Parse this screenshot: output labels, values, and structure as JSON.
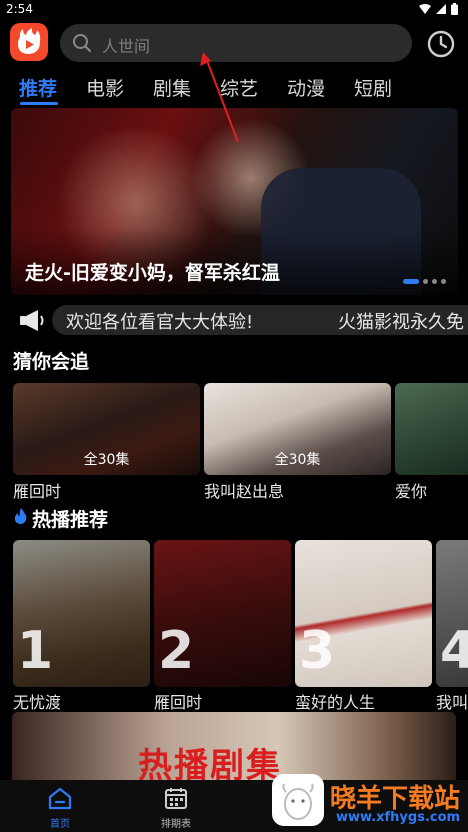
{
  "status_bar": {
    "time": "2:54"
  },
  "search": {
    "placeholder": "人世间"
  },
  "tabs": [
    {
      "label": "推荐",
      "active": true
    },
    {
      "label": "电影"
    },
    {
      "label": "剧集"
    },
    {
      "label": "综艺"
    },
    {
      "label": "动漫"
    },
    {
      "label": "短剧"
    }
  ],
  "banner": {
    "title": "走火-旧爱变小妈，督军杀红温"
  },
  "notice": {
    "text": "欢迎各位看官大大体验!",
    "text2": "火猫影视永久免"
  },
  "guess": {
    "title": "猜你会追",
    "items": [
      {
        "name": "雁回时",
        "badge": "全30集"
      },
      {
        "name": "我叫赵出息",
        "badge": "全30集"
      },
      {
        "name": "爱你",
        "badge": ""
      }
    ]
  },
  "hot": {
    "title": "热播推荐",
    "items": [
      {
        "name": "无忧渡",
        "rank": "1"
      },
      {
        "name": "雁回时",
        "rank": "2"
      },
      {
        "name": "蛮好的人生",
        "rank": "3"
      },
      {
        "name": "我叫",
        "rank": "4"
      }
    ]
  },
  "promo": {
    "title": "热播剧集"
  },
  "bottom_nav": [
    {
      "label": "首页",
      "active": true
    },
    {
      "label": "排期表"
    }
  ],
  "watermark": {
    "text": "晓羊下载站",
    "url": "www.xfhygs.com"
  },
  "colors": {
    "accent": "#2f7cf6",
    "background": "#000000",
    "logo": "#f44a2b"
  }
}
